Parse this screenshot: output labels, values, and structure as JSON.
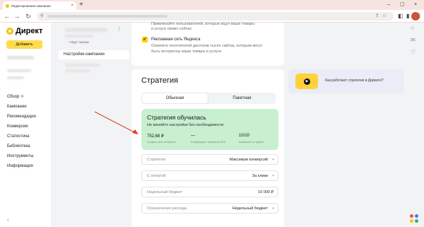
{
  "browser": {
    "tab_title": "Редактирование кампании",
    "tab_close": "×",
    "new_tab": "+",
    "back": "←",
    "forward": "→",
    "reload": "↻",
    "win_min": "–",
    "win_max": "▢",
    "win_close": "×",
    "omni_lock": "⚲",
    "omni_icons": "⇪☆",
    "ext_icon": "◧",
    "sidepanel_icon": "▮",
    "menu_icon": "⋮"
  },
  "app": {
    "logo_text": "Директ",
    "add_button": "Добавить",
    "nav": [
      {
        "label": "Обзор",
        "badge": "Я"
      },
      {
        "label": "Кампании"
      },
      {
        "label": "Рекомендации"
      },
      {
        "label": "Конверсии"
      },
      {
        "label": "Статистика"
      },
      {
        "label": "Библиотека"
      },
      {
        "label": "Инструменты"
      },
      {
        "label": "Информация"
      }
    ],
    "collapse": "‹"
  },
  "subnav": {
    "dots": "⋮",
    "link": "• Идут показы",
    "active_item": "Настройки кампании"
  },
  "top_card": {
    "line1": "Привлекайте пользователей, которые ищут ваши товары",
    "line2": "и услуги прямо сейчас",
    "checkbox": "✓",
    "checkbox_label": "Рекламная сеть Яндекса",
    "desc1": "Охватите посетителей десятков тысяч сайтов, которым могут",
    "desc2": "быть интересны ваши товары и услуги"
  },
  "strategy": {
    "title": "Стратегия",
    "tab_active": "Обычная",
    "tab_inactive": "Пакетная",
    "status_title": "Стратегия обучилась",
    "status_sub": "Не меняйте настройки без необходимости",
    "metrics": [
      {
        "value": "752,68 ₽",
        "label": "Средняя цена конверсии"
      },
      {
        "value": "—",
        "label": "Коэффициент конверсии (CR)"
      },
      {
        "value": "10/10",
        "label": "Конверсий за неделю"
      }
    ],
    "fields": [
      {
        "label": "Стратегия",
        "value": "Максимум конверсий",
        "chevron": "⌄"
      },
      {
        "label": "С оплатой",
        "value": "За клики",
        "chevron": "⌄"
      },
      {
        "label": "Недельный бюджет",
        "value": "10 000 ₽",
        "chevron": ""
      },
      {
        "label": "Ограничение расхода",
        "value": "Недельный бюджет",
        "chevron": "⌄"
      }
    ]
  },
  "promo": {
    "play": "▶",
    "text": "Как работают стратегии в Директе?"
  },
  "rail": {
    "icon1": "○",
    "icon2": "✉",
    "icon3": "♡",
    "grid_colors": [
      "#ff4f3f",
      "#3f7bff",
      "#ffc400",
      "#35b56a"
    ]
  },
  "colors": {
    "accent": "#ffdb4d",
    "success_bg": "#c8efcf",
    "annotation_arrow": "#e03b2b"
  }
}
